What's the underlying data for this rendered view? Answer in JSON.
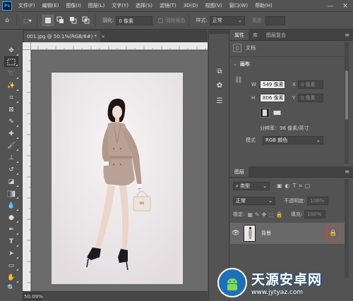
{
  "menubar": {
    "logo": "Ps",
    "items": [
      "文件(F)",
      "编辑(E)",
      "图像(I)",
      "图层(L)",
      "文字(Y)",
      "选择(S)",
      "滤镜(T)",
      "3D(D)",
      "视图(V)",
      "窗口(W)",
      "帮助(H)"
    ],
    "minimize": "—",
    "close": "✕"
  },
  "options": {
    "feather_label": "羽化:",
    "feather_value": "0 像素",
    "antialias_label": "消除锯齿",
    "style_label": "样式:",
    "style_value": "正常",
    "width_label": "宽度:"
  },
  "document": {
    "tab_label": "001.jpg @ 50.1%(RGB/8#) *",
    "tab_close": "×",
    "zoom": "50.09%"
  },
  "properties": {
    "tabs": [
      "属性",
      "库",
      "图层复合"
    ],
    "doc_label": "文档",
    "canvas_label": "画布",
    "w_label": "W",
    "w_value": "549 像素",
    "h_label": "H",
    "h_value": "806 像素",
    "x_label": "X",
    "x_value": "0 像素",
    "y_label": "Y",
    "y_value": "0 像素",
    "resolution": "分辨率：96 像素/英寸",
    "mode_label": "模式",
    "mode_value": "RGB 颜色"
  },
  "layers": {
    "tab": "图层",
    "filter_value": "类型",
    "blend_mode": "正常",
    "opacity_label": "不透明度:",
    "opacity_value": "100%",
    "lock_label": "锁定:",
    "fill_label": "填充:",
    "fill_value": "100%",
    "layer_name": "背景"
  },
  "watermark": {
    "title": "天源安卓网",
    "url": "www.jytyaz.com"
  },
  "colors": {
    "ui_bg": "#535353",
    "canvas_bg": "#6b6b6b",
    "artboard": "#ece8ea",
    "highlight": "#e23b3b",
    "field_light": "#f0f0f0"
  }
}
